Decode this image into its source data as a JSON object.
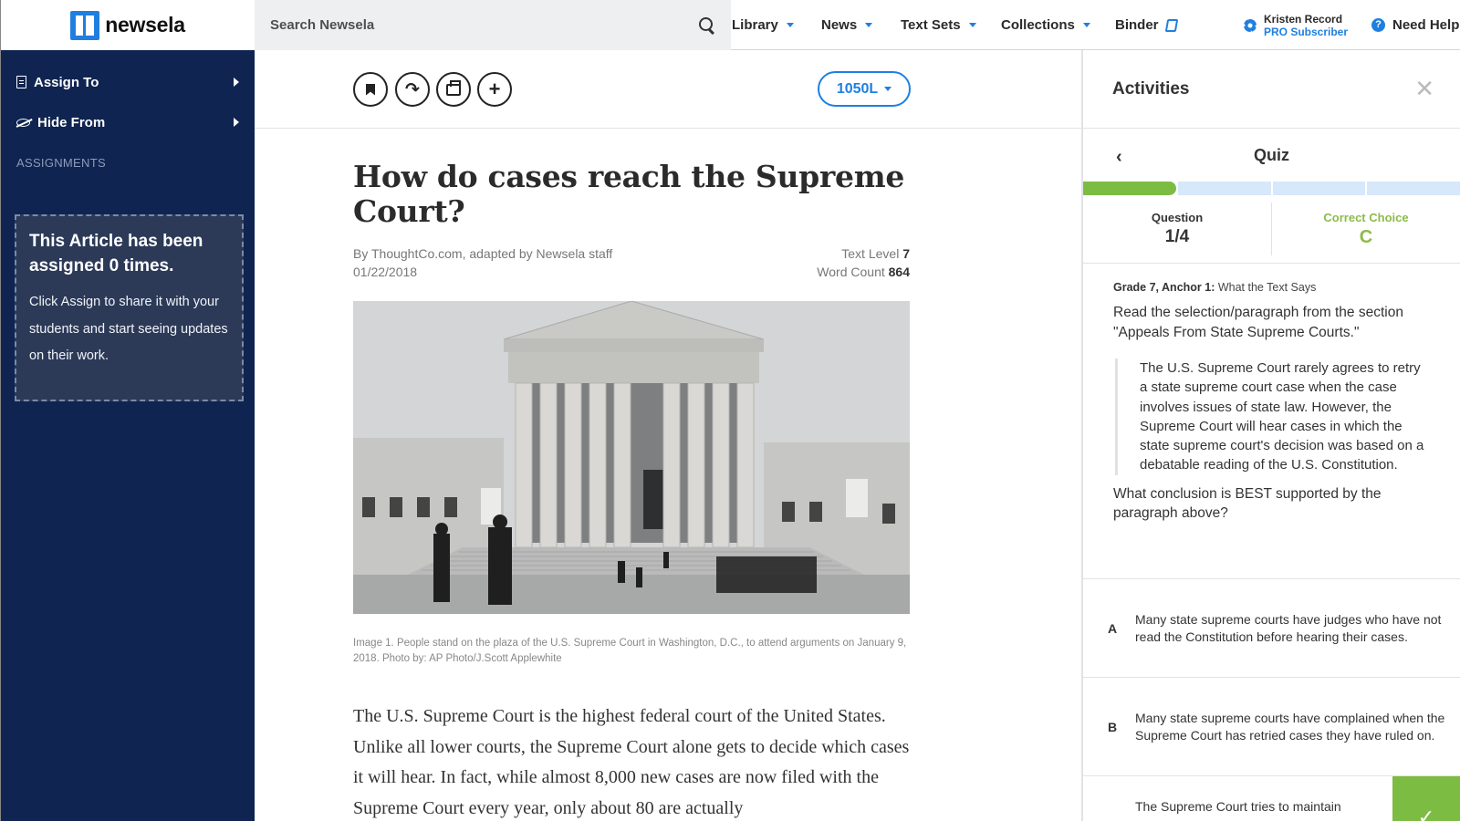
{
  "header": {
    "logo_text": "newsela",
    "search_placeholder": "Search Newsela",
    "nav": [
      {
        "label": "Library"
      },
      {
        "label": "News"
      },
      {
        "label": "Text Sets"
      },
      {
        "label": "Collections"
      }
    ],
    "binder_label": "Binder",
    "user_name": "Kristen Record",
    "user_subtitle": "PRO Subscriber",
    "help_label": "Need Help"
  },
  "sidebar": {
    "assign_to": "Assign To",
    "hide_from": "Hide From",
    "assignments_heading": "ASSIGNMENTS",
    "assign_box_title": "This Article has been assigned 0 times.",
    "assign_box_text": "Click Assign to share it with your students and start seeing updates on their work."
  },
  "article": {
    "level_button": "1050L",
    "title": "How do cases reach the Supreme Court?",
    "byline": "By ThoughtCo.com, adapted by Newsela staff",
    "date": "01/22/2018",
    "text_level_label": "Text Level",
    "text_level_value": "7",
    "word_count_label": "Word Count",
    "word_count_value": "864",
    "caption": "Image 1. People stand on the plaza of the U.S. Supreme Court in Washington, D.C., to attend arguments on January 9, 2018. Photo by: AP Photo/J.Scott Applewhite",
    "body": "The U.S. Supreme Court is the highest federal court of the United States. Unlike all lower courts, the Supreme Court alone gets to decide which cases it will hear. In fact, while almost 8,000 new cases are now filed with the Supreme Court every year, only about 80 are actually"
  },
  "activities": {
    "panel_title": "Activities",
    "quiz_title": "Quiz",
    "progress_done_fraction": 0.25,
    "question_label": "Question",
    "question_value": "1/4",
    "correct_label": "Correct Choice",
    "correct_value": "C",
    "standard_bold": "Grade 7, Anchor 1:",
    "standard_text": "What the Text Says",
    "prompt": "Read the selection/paragraph from the section \"Appeals From State Supreme Courts.\"",
    "quote": "The U.S. Supreme Court rarely agrees to retry a state supreme court case when the case involves issues of state law. However, the Supreme Court will hear cases in which the state supreme court's decision was based on a debatable reading of the U.S. Constitution.",
    "question": "What conclusion is BEST supported by the paragraph above?",
    "choices": [
      {
        "letter": "A",
        "text": "Many state supreme courts have judges who have not read the Constitution before hearing their cases."
      },
      {
        "letter": "B",
        "text": "Many state supreme courts have complained when the Supreme Court has retried cases they have ruled on."
      },
      {
        "letter": "",
        "text": "The Supreme Court tries to maintain"
      }
    ],
    "check_mark": "✓"
  },
  "colors": {
    "accent": "#1f7fe0",
    "sidebar": "#0f2450",
    "success": "#7dbc42"
  }
}
